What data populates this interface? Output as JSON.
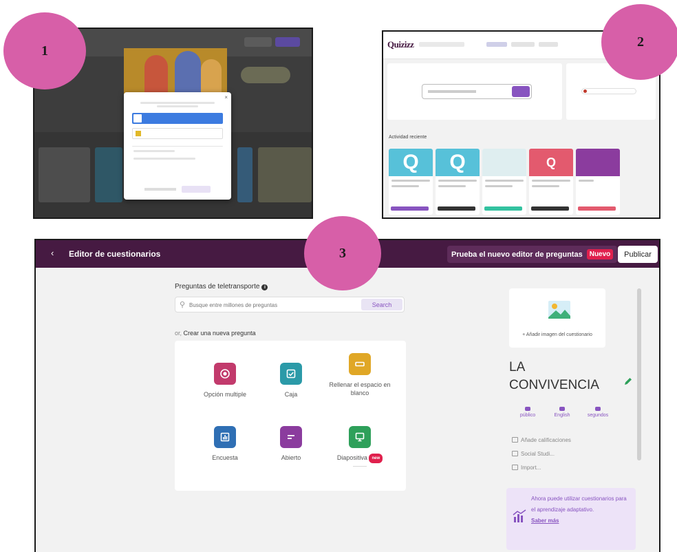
{
  "steps": [
    "1",
    "2",
    "3"
  ],
  "shot2": {
    "logo": "Quizizz",
    "recent_label": "Actividad reciente"
  },
  "editor": {
    "title": "Editor de cuestionarios",
    "try_new_editor": "Prueba el nuevo editor de preguntas",
    "new_badge": "Nuevo",
    "publish": "Publicar",
    "teleport_label": "Preguntas de teletransporte",
    "search_placeholder": "Busque entre millones de preguntas",
    "search_button": "Search",
    "create_prefix": "or,",
    "create_label": "Crear una nueva pregunta",
    "question_types": [
      {
        "label": "Opción multiple",
        "color": "#c23a6c"
      },
      {
        "label": "Caja",
        "color": "#2b9aa8"
      },
      {
        "label": "Rellenar el espacio en blanco",
        "color": "#e0a726"
      },
      {
        "label": "Encuesta",
        "color": "#2f6fb4"
      },
      {
        "label": "Abierto",
        "color": "#8b3c9e"
      },
      {
        "label": "Diapositiva",
        "color": "#2ea05a",
        "badge": "new"
      }
    ],
    "add_image": "+ Añadir imagen del cuestionario",
    "quiz_name_line1": "LA",
    "quiz_name_line2": "CONVIVENCIA",
    "meta": [
      "público",
      "English",
      "segundos"
    ],
    "meta_items": [
      "Añade calificaciones",
      "Social Studi...",
      "Import..."
    ],
    "adaptive_text": "Ahora puede utilizar cuestionarios para el aprendizaje adaptativo.",
    "adaptive_link": "Saber más",
    "accent": "#461a42",
    "purple": "#8854c0"
  }
}
